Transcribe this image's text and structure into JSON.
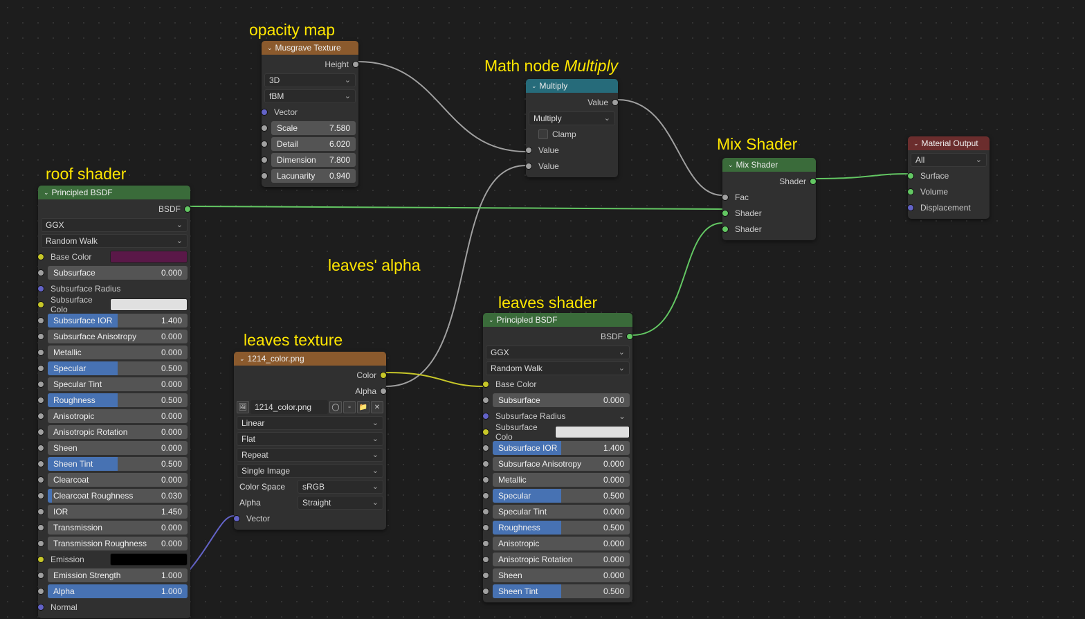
{
  "labels": {
    "opacity_map": "opacity map",
    "roof_shader": "roof shader",
    "math_node": "Math node ",
    "math_node_em": "Multiply",
    "leaves_alpha": "leaves' alpha",
    "leaves_texture": "leaves texture",
    "leaves_shader": "leaves shader",
    "mix_shader": "Mix Shader"
  },
  "musgrave": {
    "title": "Musgrave Texture",
    "out_height": "Height",
    "dim_mode": "3D",
    "type": "fBM",
    "vector": "Vector",
    "scale_l": "Scale",
    "scale_v": "7.580",
    "detail_l": "Detail",
    "detail_v": "6.020",
    "dimension_l": "Dimension",
    "dimension_v": "7.800",
    "lacunarity_l": "Lacunarity",
    "lacunarity_v": "0.940"
  },
  "multiply": {
    "title": "Multiply",
    "out_value": "Value",
    "op": "Multiply",
    "clamp": "Clamp",
    "in1": "Value",
    "in2": "Value"
  },
  "mix": {
    "title": "Mix Shader",
    "out": "Shader",
    "fac": "Fac",
    "shader1": "Shader",
    "shader2": "Shader"
  },
  "matout": {
    "title": "Material Output",
    "target": "All",
    "surface": "Surface",
    "volume": "Volume",
    "displacement": "Displacement"
  },
  "principled_roof": {
    "title": "Principled BSDF",
    "out_bsdf": "BSDF",
    "distribution": "GGX",
    "subsurface_method": "Random Walk",
    "base_color": "Base Color",
    "base_color_hex": "#5a1848",
    "subsurface_l": "Subsurface",
    "subsurface_v": "0.000",
    "subsurface_radius": "Subsurface Radius",
    "subsurface_color": "Subsurface Colo",
    "subsurface_color_hex": "#e0e0e0",
    "subsurface_ior_l": "Subsurface IOR",
    "subsurface_ior_v": "1.400",
    "subsurface_aniso_l": "Subsurface Anisotropy",
    "subsurface_aniso_v": "0.000",
    "metallic_l": "Metallic",
    "metallic_v": "0.000",
    "specular_l": "Specular",
    "specular_v": "0.500",
    "specular_tint_l": "Specular Tint",
    "specular_tint_v": "0.000",
    "roughness_l": "Roughness",
    "roughness_v": "0.500",
    "anisotropic_l": "Anisotropic",
    "anisotropic_v": "0.000",
    "aniso_rot_l": "Anisotropic Rotation",
    "aniso_rot_v": "0.000",
    "sheen_l": "Sheen",
    "sheen_v": "0.000",
    "sheen_tint_l": "Sheen Tint",
    "sheen_tint_v": "0.500",
    "clearcoat_l": "Clearcoat",
    "clearcoat_v": "0.000",
    "clearcoat_rough_l": "Clearcoat Roughness",
    "clearcoat_rough_v": "0.030",
    "ior_l": "IOR",
    "ior_v": "1.450",
    "transmission_l": "Transmission",
    "transmission_v": "0.000",
    "transmission_rough_l": "Transmission Roughness",
    "transmission_rough_v": "0.000",
    "emission": "Emission",
    "emission_hex": "#000000",
    "emission_str_l": "Emission Strength",
    "emission_str_v": "1.000",
    "alpha_l": "Alpha",
    "alpha_v": "1.000",
    "normal": "Normal"
  },
  "image_tex": {
    "title": "1214_color.png",
    "out_color": "Color",
    "out_alpha": "Alpha",
    "filename": "1214_color.png",
    "interp": "Linear",
    "projection": "Flat",
    "extension": "Repeat",
    "source": "Single Image",
    "colorspace_l": "Color Space",
    "colorspace_v": "sRGB",
    "alpha_l": "Alpha",
    "alpha_v": "Straight",
    "vector": "Vector"
  },
  "principled_leaves": {
    "title": "Principled BSDF",
    "out_bsdf": "BSDF",
    "distribution": "GGX",
    "subsurface_method": "Random Walk",
    "base_color": "Base Color",
    "subsurface_l": "Subsurface",
    "subsurface_v": "0.000",
    "subsurface_radius": "Subsurface Radius",
    "subsurface_color": "Subsurface Colo",
    "subsurface_color_hex": "#e0e0e0",
    "subsurface_ior_l": "Subsurface IOR",
    "subsurface_ior_v": "1.400",
    "subsurface_aniso_l": "Subsurface Anisotropy",
    "subsurface_aniso_v": "0.000",
    "metallic_l": "Metallic",
    "metallic_v": "0.000",
    "specular_l": "Specular",
    "specular_v": "0.500",
    "specular_tint_l": "Specular Tint",
    "specular_tint_v": "0.000",
    "roughness_l": "Roughness",
    "roughness_v": "0.500",
    "anisotropic_l": "Anisotropic",
    "anisotropic_v": "0.000",
    "aniso_rot_l": "Anisotropic Rotation",
    "aniso_rot_v": "0.000",
    "sheen_l": "Sheen",
    "sheen_v": "0.000",
    "sheen_tint_l": "Sheen Tint",
    "sheen_tint_v": "0.500"
  }
}
